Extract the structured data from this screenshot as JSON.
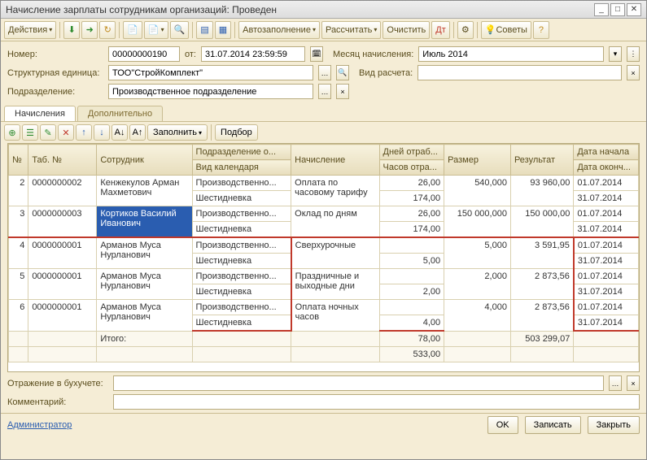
{
  "title": "Начисление зарплаты сотрудникам организаций: Проведен",
  "toolbar": {
    "actions": "Действия",
    "autofill": "Автозаполнение",
    "calc": "Рассчитать",
    "clear": "Очистить",
    "advice": "Советы"
  },
  "form": {
    "number_label": "Номер:",
    "number": "00000000190",
    "from_label": "от:",
    "from": "31.07.2014 23:59:59",
    "month_label": "Месяц начисления:",
    "month": "Июль 2014",
    "unit_label": "Структурная единица:",
    "unit": "ТОО\"СтройКомплект\"",
    "calc_type_label": "Вид расчета:",
    "division_label": "Подразделение:",
    "division": "Производственное подразделение"
  },
  "tabs": {
    "t1": "Начисления",
    "t2": "Дополнительно"
  },
  "inner_toolbar": {
    "fill": "Заполнить",
    "pick": "Подбор"
  },
  "columns": {
    "idx": "№",
    "tab": "Таб. №",
    "emp": "Сотрудник",
    "dept": "Подразделение о...",
    "cal": "Вид календаря",
    "acc": "Начисление",
    "days": "Дней отраб...",
    "hours": "Часов отра...",
    "size": "Размер",
    "result": "Результат",
    "start": "Дата начала",
    "end": "Дата оконч..."
  },
  "rows": [
    {
      "n": "2",
      "tab": "0000000002",
      "emp": "Кенжекулов Арман Махметович",
      "dept": "Производственно...",
      "cal": "Шестидневка",
      "acc": "Оплата по часовому тарифу",
      "days": "26,00",
      "hours": "174,00",
      "size": "540,000",
      "res": "93 960,00",
      "d1": "01.07.2014",
      "d2": "31.07.2014"
    },
    {
      "n": "3",
      "tab": "0000000003",
      "emp": "Кортиков Василий Иванович",
      "dept": "Производственно...",
      "cal": "Шестидневка",
      "acc": "Оклад по дням",
      "days": "26,00",
      "hours": "174,00",
      "size": "150 000,000",
      "res": "150 000,00",
      "d1": "01.07.2014",
      "d2": "31.07.2014",
      "selected": true
    },
    {
      "n": "4",
      "tab": "0000000001",
      "emp": "Арманов Муса Нурланович",
      "dept": "Производственно...",
      "cal": "Шестидневка",
      "acc": "Сверхурочные",
      "days": "",
      "hours": "5,00",
      "size": "5,000",
      "res": "3 591,95",
      "d1": "01.07.2014",
      "d2": "31.07.2014",
      "red": "top"
    },
    {
      "n": "5",
      "tab": "0000000001",
      "emp": "Арманов Муса Нурланович",
      "dept": "Производственно...",
      "cal": "Шестидневка",
      "acc": "Праздничные и выходные дни",
      "days": "",
      "hours": "2,00",
      "size": "2,000",
      "res": "2 873,56",
      "d1": "01.07.2014",
      "d2": "31.07.2014",
      "red": "mid"
    },
    {
      "n": "6",
      "tab": "0000000001",
      "emp": "Арманов Муса Нурланович",
      "dept": "Производственно...",
      "cal": "Шестидневка",
      "acc": "Оплата ночных часов",
      "days": "",
      "hours": "4,00",
      "size": "4,000",
      "res": "2 873,56",
      "d1": "01.07.2014",
      "d2": "31.07.2014",
      "red": "bottom"
    }
  ],
  "totals": {
    "label": "Итого:",
    "days": "78,00",
    "hours": "533,00",
    "res": "503 299,07"
  },
  "footer": {
    "acct_label": "Отражение в бухучете:",
    "comment_label": "Комментарий:",
    "user": "Администратор",
    "ok": "OK",
    "save": "Записать",
    "close": "Закрыть"
  }
}
